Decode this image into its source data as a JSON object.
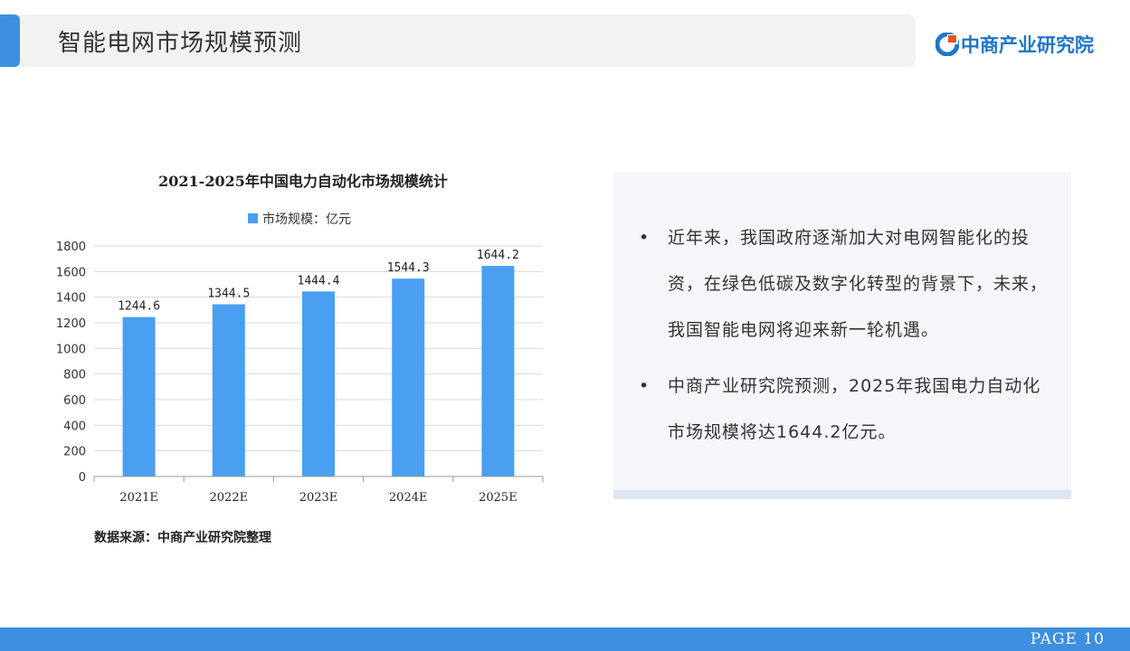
{
  "header": {
    "title": "智能电网市场规模预测",
    "logo_text": "中商产业研究院"
  },
  "colors": {
    "accent": "#3d8fdf",
    "bar": "#4a9ff0",
    "logo": "#1f76c8"
  },
  "chart_data": {
    "type": "bar",
    "title": "2021-2025年中国电力自动化市场规模统计",
    "categories": [
      "2021E",
      "2022E",
      "2023E",
      "2024E",
      "2025E"
    ],
    "series": [
      {
        "name": "市场规模：亿元",
        "values": [
          1244.6,
          1344.5,
          1444.4,
          1544.3,
          1644.2
        ]
      }
    ],
    "ylim": [
      0,
      1800
    ],
    "yticks": [
      0,
      200,
      400,
      600,
      800,
      1000,
      1200,
      1400,
      1600,
      1800
    ],
    "grid": true,
    "legend": "top"
  },
  "source_note": "数据来源：中商产业研究院整理",
  "bullets": [
    "近年来，我国政府逐渐加大对电网智能化的投资，在绿色低碳及数字化转型的背景下，未来，我国智能电网将迎来新一轮机遇。",
    "中商产业研究院预测，2025年我国电力自动化市场规模将达1644.2亿元。"
  ],
  "footer": {
    "page_label": "PAGE  10"
  }
}
